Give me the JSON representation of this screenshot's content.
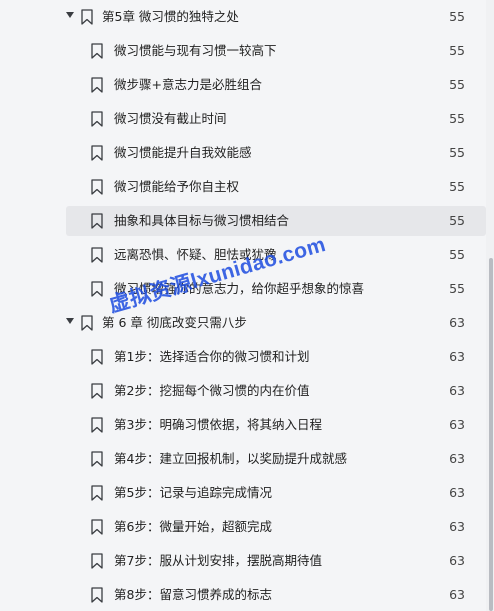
{
  "items": [
    {
      "type": "chapter",
      "label": "第5章 微习惯的独特之处",
      "page": "55"
    },
    {
      "type": "section",
      "label": "微习惯能与现有习惯一较高下",
      "page": "55"
    },
    {
      "type": "section",
      "label": "微步骤+意志力是必胜组合",
      "page": "55"
    },
    {
      "type": "section",
      "label": "微习惯没有截止时间",
      "page": "55"
    },
    {
      "type": "section",
      "label": "微习惯能提升自我效能感",
      "page": "55"
    },
    {
      "type": "section",
      "label": "微习惯能给予你自主权",
      "page": "55"
    },
    {
      "type": "section",
      "label": "抽象和具体目标与微习惯相结合",
      "page": "55",
      "active": true
    },
    {
      "type": "section",
      "label": "远离恐惧、怀疑、胆怯或犹豫",
      "page": "55"
    },
    {
      "type": "section",
      "label": "微习惯增强你的意志力，给你超乎想象的惊喜",
      "page": "55"
    },
    {
      "type": "chapter",
      "label": "第 6 章 彻底改变只需八步",
      "page": "63"
    },
    {
      "type": "section",
      "label": "第1步：选择适合你的微习惯和计划",
      "page": "63"
    },
    {
      "type": "section",
      "label": "第2步：挖掘每个微习惯的内在价值",
      "page": "63"
    },
    {
      "type": "section",
      "label": "第3步：明确习惯依据，将其纳入日程",
      "page": "63"
    },
    {
      "type": "section",
      "label": "第4步：建立回报机制，以奖励提升成就感",
      "page": "63"
    },
    {
      "type": "section",
      "label": "第5步：记录与追踪完成情况",
      "page": "63"
    },
    {
      "type": "section",
      "label": "第6步：微量开始，超额完成",
      "page": "63"
    },
    {
      "type": "section",
      "label": "第7步：服从计划安排，摆脱高期待值",
      "page": "63"
    },
    {
      "type": "section",
      "label": "第8步：留意习惯养成的标志",
      "page": "63"
    }
  ],
  "watermark": "虚拟资源lxunidao.com"
}
